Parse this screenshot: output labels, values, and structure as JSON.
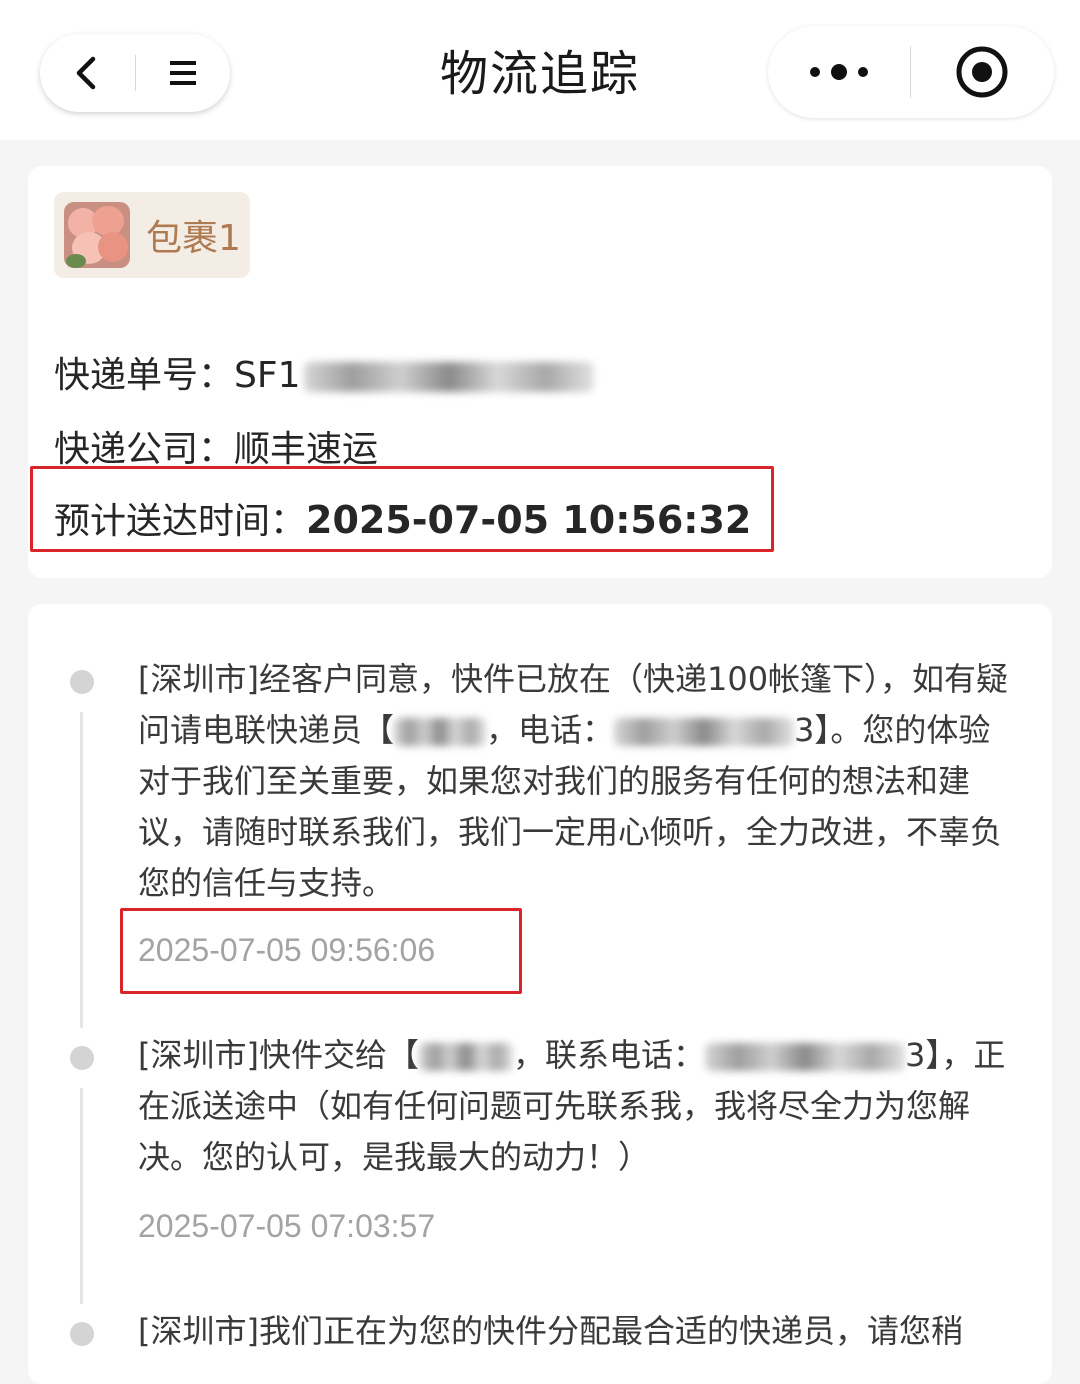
{
  "header": {
    "title": "物流追踪",
    "back_icon": "chevron-left-icon",
    "menu_icon": "hamburger-menu-icon",
    "more_icon": "more-dots-icon",
    "close_icon": "target-circle-icon"
  },
  "package": {
    "tab_label": "包裹1",
    "tracking_label": "快递单号：",
    "tracking_prefix": "SF1",
    "company_label": "快递公司：",
    "company_value": "顺丰速运",
    "eta_label": "预计送达时间：",
    "eta_value": "2025-07-05 10:56:32"
  },
  "timeline": [
    {
      "pre": "[深圳市]经客户同意，快件已放在（快递100帐篷下），如有疑问请电联快递员【",
      "mid": "，电话：",
      "post": "3】。您的体验对于我们至关重要，如果您对我们的服务有任何的想法和建议，请随时联系我们，我们一定用心倾听，全力改进，不辜负您的信任与支持。",
      "time": "2025-07-05 09:56:06"
    },
    {
      "pre": "[深圳市]快件交给【",
      "mid": "，联系电话：",
      "post": "3】，正在派送途中（如有任何问题可先联系我，我将尽全力为您解决。您的认可，是我最大的动力！）",
      "time": "2025-07-05 07:03:57"
    },
    {
      "text": "[深圳市]我们正在为您的快件分配最合适的快递员，请您稍"
    }
  ],
  "colors": {
    "highlight": "#d9252a",
    "tab_bg": "#f3ede6",
    "tab_text": "#b07a50"
  }
}
